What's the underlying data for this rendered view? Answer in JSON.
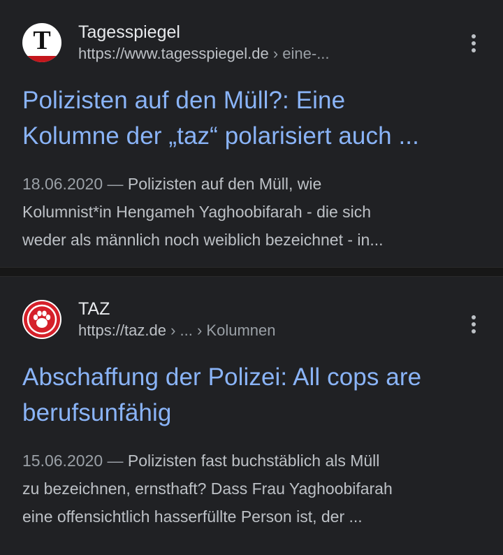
{
  "colors": {
    "background": "#202124",
    "title_link": "#8ab4f8",
    "snippet_text": "#bdc1c6",
    "date_text": "#9aa0a6",
    "tagesspiegel_red": "#c4161c",
    "taz_red": "#d5202a"
  },
  "results": [
    {
      "favicon": "tagesspiegel-logo-icon",
      "favicon_letter": "T",
      "site_name": "Tagesspiegel",
      "url_domain": "https://www.tagesspiegel.de",
      "url_path": " › eine-...",
      "title_line1": "Polizisten auf den Müll?: Eine",
      "title_line2": "Kolumne der „taz“ polarisiert auch ...",
      "date": "18.06.2020",
      "separator": " — ",
      "snippet_line1": "Polizisten auf den Müll, wie",
      "snippet_line2": "Kolumnist*in Hengameh Yaghoobifarah - die sich",
      "snippet_line3": "weder als männlich noch weiblich bezeichnet - in...",
      "more_icon": "more-vertical-icon"
    },
    {
      "favicon": "taz-paw-logo-icon",
      "site_name": "TAZ",
      "url_domain": "https://taz.de",
      "url_path": " › ... › Kolumnen",
      "title_line1": "Abschaffung der Polizei: All cops are",
      "title_line2": "berufsunfähig",
      "date": "15.06.2020",
      "separator": " — ",
      "snippet_line1": "Polizisten fast buchstäblich als Müll",
      "snippet_line2": "zu bezeichnen, ernsthaft? Dass Frau Yaghoobifarah",
      "snippet_line3": "eine offensichtlich hasserfüllte Person ist, der ...",
      "more_icon": "more-vertical-icon"
    }
  ]
}
